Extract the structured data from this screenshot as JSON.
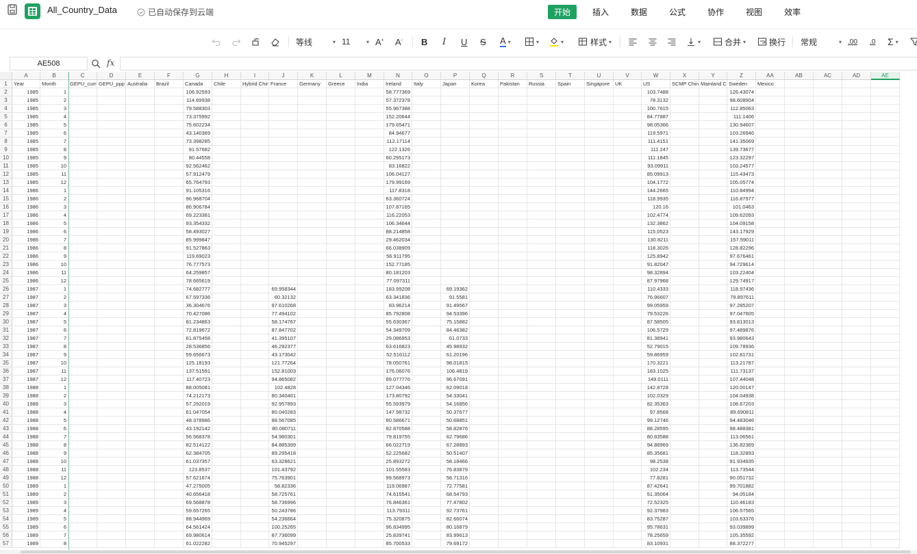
{
  "titlebar": {
    "file_title": "All_Country_Data",
    "autosave_text": "已自动保存到云端",
    "menu": [
      {
        "label": "开始",
        "active": true
      },
      {
        "label": "插入",
        "active": false
      },
      {
        "label": "数据",
        "active": false
      },
      {
        "label": "公式",
        "active": false
      },
      {
        "label": "协作",
        "active": false
      },
      {
        "label": "视图",
        "active": false
      },
      {
        "label": "效率",
        "active": false
      }
    ]
  },
  "toolbar": {
    "font_name": "等线",
    "font_size": "11",
    "styles_label": "样式",
    "merge_label": "合并",
    "wrap_label": "换行",
    "number_format": "常规",
    "decimal_inc": ".00",
    "decimal_dec": ".0"
  },
  "formula_bar": {
    "name_box": "AE508",
    "fx_label": "fx",
    "formula": ""
  },
  "grid": {
    "columns": [
      "A",
      "B",
      "C",
      "D",
      "E",
      "F",
      "G",
      "H",
      "I",
      "J",
      "K",
      "L",
      "M",
      "N",
      "O",
      "P",
      "Q",
      "R",
      "S",
      "T",
      "U",
      "V",
      "W",
      "X",
      "Y",
      "Z",
      "AA",
      "AB",
      "AC",
      "AD",
      "AE"
    ],
    "selected_column": "AE",
    "headers": [
      "Year",
      "Month",
      "GEPU_current",
      "GEPU_ppp",
      "Australia",
      "Brazil",
      "Canada",
      "Chile",
      "Hybrid China",
      "France",
      "Germany",
      "Greece",
      "India",
      "Ireland",
      "Italy",
      "Japan",
      "Korea",
      "Pakistan",
      "Russia",
      "Spain",
      "Singapore",
      "UK",
      "US",
      "SCMP China",
      "Mainland China",
      "Sweden",
      "Mexico"
    ],
    "rows": [
      {
        "year": "1985",
        "month": "1",
        "G": "106.92593",
        "N": "58.777369",
        "W": "103.7488",
        "Z": "126.43074"
      },
      {
        "year": "1985",
        "month": "2",
        "G": "114.69938",
        "N": "57.372378",
        "W": "78.3132",
        "Z": "98.608904"
      },
      {
        "year": "1985",
        "month": "3",
        "G": "79.588303",
        "N": "55.967388",
        "W": "100.7615",
        "Z": "112.85063"
      },
      {
        "year": "1985",
        "month": "4",
        "G": "73.375992",
        "N": "152.20644",
        "W": "84.77887",
        "Z": "111.1406"
      },
      {
        "year": "1985",
        "month": "5",
        "G": "75.602234",
        "N": "179.65471",
        "W": "98.05366",
        "Z": "130.94607"
      },
      {
        "year": "1985",
        "month": "6",
        "G": "43.140369",
        "N": "84.94677",
        "W": "119.5971",
        "Z": "103.26946"
      },
      {
        "year": "1985",
        "month": "7",
        "G": "73.398285",
        "N": "112.17114",
        "W": "111.4151",
        "Z": "141.35069"
      },
      {
        "year": "1985",
        "month": "8",
        "G": "91.57682",
        "N": "122.1326",
        "W": "111.247",
        "Z": "139.73677"
      },
      {
        "year": "1985",
        "month": "9",
        "G": "80.44558",
        "N": "60.295173",
        "W": "111.1845",
        "Z": "123.32297"
      },
      {
        "year": "1985",
        "month": "10",
        "G": "92.562462",
        "N": "83.16822",
        "W": "93.09911",
        "Z": "103.24577"
      },
      {
        "year": "1985",
        "month": "11",
        "G": "57.912479",
        "N": "106.04127",
        "W": "85.09913",
        "Z": "115.43473"
      },
      {
        "year": "1985",
        "month": "12",
        "G": "65.764793",
        "N": "179.99169",
        "W": "104.1772",
        "Z": "105.05774"
      },
      {
        "year": "1986",
        "month": "1",
        "G": "91.105316",
        "N": "117.8318",
        "W": "144.2665",
        "Z": "110.84994"
      },
      {
        "year": "1986",
        "month": "2",
        "G": "96.968704",
        "N": "63.360724",
        "W": "118.9935",
        "Z": "116.87977"
      },
      {
        "year": "1986",
        "month": "3",
        "G": "86.906784",
        "N": "107.87165",
        "W": "120.16",
        "Z": "101.0463"
      },
      {
        "year": "1986",
        "month": "4",
        "G": "69.223381",
        "N": "116.22053",
        "W": "102.4774",
        "Z": "109.62093"
      },
      {
        "year": "1986",
        "month": "5",
        "G": "93.354332",
        "N": "106.34644",
        "W": "132.3862",
        "Z": "104.09158"
      },
      {
        "year": "1986",
        "month": "6",
        "G": "58.493027",
        "N": "88.214858",
        "W": "115.0523",
        "Z": "143.17929"
      },
      {
        "year": "1986",
        "month": "7",
        "G": "85.999847",
        "N": "29.462034",
        "W": "130.8211",
        "Z": "157.59011"
      },
      {
        "year": "1986",
        "month": "8",
        "G": "91.527863",
        "N": "66.038909",
        "W": "118.3026",
        "Z": "128.82296"
      },
      {
        "year": "1986",
        "month": "9",
        "G": "119.69023",
        "N": "56.911795",
        "W": "125.8942",
        "Z": "97.676461"
      },
      {
        "year": "1986",
        "month": "10",
        "G": "76.777573",
        "N": "152.77185",
        "W": "91.82047",
        "Z": "94.729614"
      },
      {
        "year": "1986",
        "month": "11",
        "G": "64.259857",
        "N": "80.181203",
        "W": "98.32894",
        "Z": "103.22404"
      },
      {
        "year": "1986",
        "month": "12",
        "G": "78.665619",
        "N": "77.097311",
        "W": "87.97968",
        "Z": "129.74917"
      },
      {
        "year": "1987",
        "month": "1",
        "G": "74.682777",
        "J": "69.958344",
        "N": "183.99208",
        "P": "69.19362",
        "W": "110.4333",
        "Z": "118.97436"
      },
      {
        "year": "1987",
        "month": "2",
        "G": "67.597336",
        "J": "60.32132",
        "N": "63.341836",
        "P": "91.5581",
        "W": "76.96607",
        "Z": "79.897611"
      },
      {
        "year": "1987",
        "month": "3",
        "G": "36.304676",
        "J": "97.610268",
        "N": "83.96214",
        "P": "91.49567",
        "W": "99.05959",
        "Z": "97.285207"
      },
      {
        "year": "1987",
        "month": "4",
        "G": "70.427086",
        "J": "77.494102",
        "N": "85.792808",
        "P": "94.53396",
        "W": "79.53226",
        "Z": "97.047605"
      },
      {
        "year": "1987",
        "month": "5",
        "G": "81.234863",
        "J": "58.174767",
        "N": "55.630367",
        "P": "75.15882",
        "W": "87.58505",
        "Z": "93.813013"
      },
      {
        "year": "1987",
        "month": "6",
        "G": "72.819672",
        "J": "87.847702",
        "N": "54.349709",
        "P": "84.46382",
        "W": "106.5729",
        "Z": "97.489876"
      },
      {
        "year": "1987",
        "month": "7",
        "G": "61.875458",
        "J": "41.395107",
        "N": "29.086953",
        "P": "61.0733",
        "W": "81.38941",
        "Z": "93.980643"
      },
      {
        "year": "1987",
        "month": "8",
        "G": "28.536856",
        "J": "46.292377",
        "N": "63.616823",
        "P": "45.98932",
        "W": "52.79015",
        "Z": "109.78936"
      },
      {
        "year": "1987",
        "month": "9",
        "G": "59.656673",
        "J": "43.173042",
        "N": "52.516112",
        "P": "61.20196",
        "W": "59.86959",
        "Z": "102.81731"
      },
      {
        "year": "1987",
        "month": "10",
        "G": "125.18193",
        "J": "121.77264",
        "N": "78.050761",
        "P": "98.01815",
        "W": "170.3221",
        "Z": "113.21787"
      },
      {
        "year": "1987",
        "month": "11",
        "G": "137.51591",
        "J": "152.81003",
        "N": "176.06076",
        "P": "106.4819",
        "W": "183.1025",
        "Z": "111.73137"
      },
      {
        "year": "1987",
        "month": "12",
        "G": "117.40723",
        "J": "94.865082",
        "N": "89.077776",
        "P": "96.67091",
        "W": "149.0111",
        "Z": "107.44048"
      },
      {
        "year": "1988",
        "month": "1",
        "G": "88.005081",
        "J": "102.4828",
        "N": "127.04346",
        "P": "62.09018",
        "W": "142.8728",
        "Z": "120.00147"
      },
      {
        "year": "1988",
        "month": "2",
        "G": "74.212173",
        "J": "80.340401",
        "N": "173.80792",
        "P": "54.33041",
        "W": "102.0329",
        "Z": "104.04938"
      },
      {
        "year": "1988",
        "month": "3",
        "G": "57.292019",
        "J": "92.957893",
        "N": "55.593979",
        "P": "54.16856",
        "W": "82.35363",
        "Z": "108.67203"
      },
      {
        "year": "1988",
        "month": "4",
        "G": "61.047054",
        "J": "80.040283",
        "N": "147.98732",
        "P": "50.37677",
        "W": "97.8568",
        "Z": "89.690811"
      },
      {
        "year": "1988",
        "month": "5",
        "G": "48.378986",
        "J": "88.567085",
        "N": "80.586671",
        "P": "50.68851",
        "W": "99.12746",
        "Z": "94.483046"
      },
      {
        "year": "1988",
        "month": "6",
        "G": "43.192142",
        "J": "80.080711",
        "N": "82.870588",
        "P": "58.82876",
        "W": "88.28595",
        "Z": "98.488381"
      },
      {
        "year": "1988",
        "month": "7",
        "G": "56.568378",
        "J": "54.980301",
        "N": "79.819755",
        "P": "62.79686",
        "W": "80.83588",
        "Z": "113.06561"
      },
      {
        "year": "1988",
        "month": "8",
        "G": "82.514122",
        "J": "84.885399",
        "N": "66.022719",
        "P": "67.28893",
        "W": "94.88969",
        "Z": "136.82369"
      },
      {
        "year": "1988",
        "month": "9",
        "G": "62.384705",
        "J": "89.295418",
        "N": "52.225682",
        "P": "50.51407",
        "W": "85.35681",
        "Z": "118.32893"
      },
      {
        "year": "1988",
        "month": "10",
        "G": "61.037357",
        "J": "63.328621",
        "N": "25.893272",
        "P": "58.18466",
        "W": "98.2538",
        "Z": "91.934935"
      },
      {
        "year": "1988",
        "month": "11",
        "G": "123.8537",
        "J": "101.43792",
        "N": "101.55583",
        "P": "76.83879",
        "W": "102.234",
        "Z": "113.73544"
      },
      {
        "year": "1988",
        "month": "12",
        "G": "57.621674",
        "J": "75.763901",
        "N": "99.568973",
        "P": "58.71316",
        "W": "77.8281",
        "Z": "90.051732"
      },
      {
        "year": "1989",
        "month": "1",
        "G": "47.275005",
        "J": "58.82336",
        "N": "119.06987",
        "P": "72.77581",
        "W": "87.42641",
        "Z": "99.701882"
      },
      {
        "year": "1989",
        "month": "2",
        "G": "40.656418",
        "J": "58.725761",
        "N": "74.615541",
        "P": "68.54793",
        "W": "51.35064",
        "Z": "94.05184"
      },
      {
        "year": "1989",
        "month": "3",
        "G": "69.568878",
        "J": "58.736996",
        "N": "76.846361",
        "P": "77.47802",
        "W": "72.52325",
        "Z": "110.46183"
      },
      {
        "year": "1989",
        "month": "4",
        "G": "59.657265",
        "J": "50.243786",
        "N": "113.79311",
        "P": "92.73761",
        "W": "92.37983",
        "Z": "106.57565"
      },
      {
        "year": "1989",
        "month": "5",
        "G": "88.944969",
        "J": "54.236664",
        "N": "75.320875",
        "P": "82.66074",
        "W": "83.75287",
        "Z": "103.63376"
      },
      {
        "year": "1989",
        "month": "6",
        "G": "64.561424",
        "J": "100.25265",
        "N": "96.834995",
        "P": "80.16879",
        "W": "95.78631",
        "Z": "93.039899"
      },
      {
        "year": "1989",
        "month": "7",
        "G": "69.980614",
        "J": "87.736099",
        "N": "25.839741",
        "P": "83.99613",
        "W": "78.25659",
        "Z": "105.35592"
      },
      {
        "year": "1989",
        "month": "8",
        "G": "61.022282",
        "J": "70.945297",
        "N": "85.700533",
        "P": "79.69172",
        "W": "83.10931",
        "Z": "88.372277"
      }
    ]
  }
}
